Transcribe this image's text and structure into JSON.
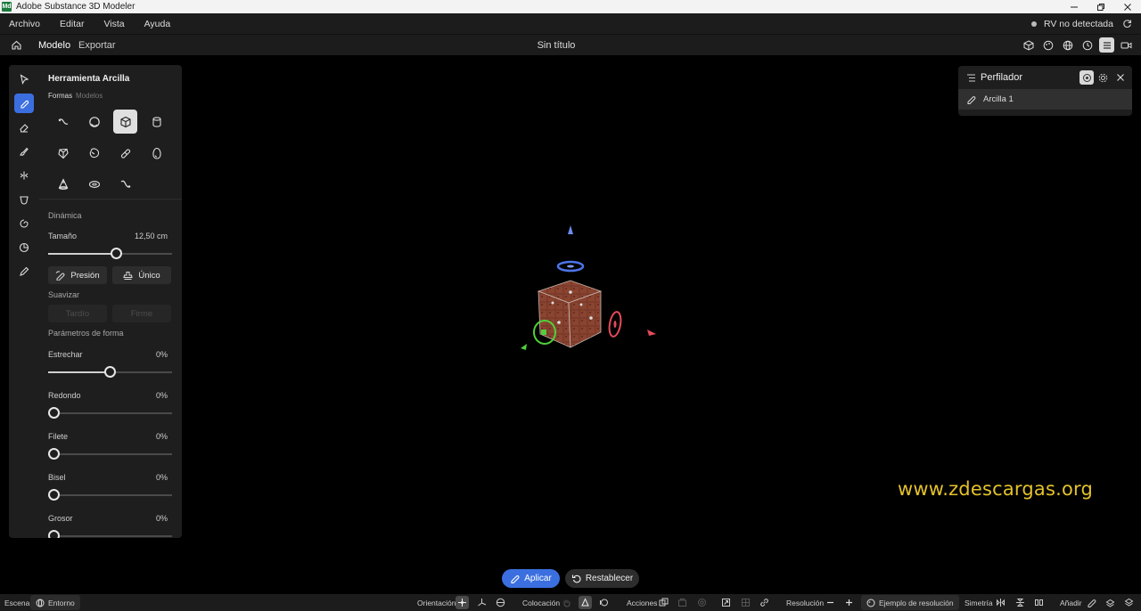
{
  "window": {
    "title": "Adobe Substance 3D Modeler",
    "app_icon_text": "Md"
  },
  "menu": {
    "items": [
      "Archivo",
      "Editar",
      "Vista",
      "Ayuda"
    ],
    "vr_status": "RV no detectada"
  },
  "toolbar": {
    "tab_model": "Modelo",
    "tab_export": "Exportar",
    "doc_title": "Sin título"
  },
  "panel": {
    "title": "Herramienta Arcilla",
    "tab_shapes": "Formas",
    "tab_models": "Modelos",
    "dynamics": "Dinámica",
    "size_label": "Tamaño",
    "size_value": "12,50 cm",
    "size_level": 0.55,
    "pressure": "Presión",
    "single": "Único",
    "smooth": "Suavizar",
    "late": "Tardío",
    "firm": "Firme",
    "shape_params": "Parámetros de forma",
    "stretch_label": "Estrechar",
    "stretch_value": "0%",
    "round_label": "Redondo",
    "round_value": "0%",
    "fillet_label": "Filete",
    "fillet_value": "0%",
    "bevel_label": "Bisel",
    "bevel_value": "0%",
    "thickness_label": "Grosor",
    "thickness_value": "0%"
  },
  "profiler": {
    "title": "Perfilador",
    "item": "Arcilla 1"
  },
  "viewport": {
    "watermark": "www.zdescargas.org"
  },
  "actions": {
    "apply": "Aplicar",
    "reset": "Restablecer"
  },
  "status": {
    "scene": "Escena",
    "environment": "Entorno",
    "orientation": "Orientación",
    "placement": "Colocación",
    "actions": "Acciones",
    "resolution": "Resolución",
    "resolution_example": "Ejemplo de resolución",
    "symmetry": "Simetría",
    "add": "Añadir"
  },
  "colors": {
    "accent": "#3b6fe0",
    "watermark": "#e3c22a",
    "panel": "#1e1e1e"
  }
}
